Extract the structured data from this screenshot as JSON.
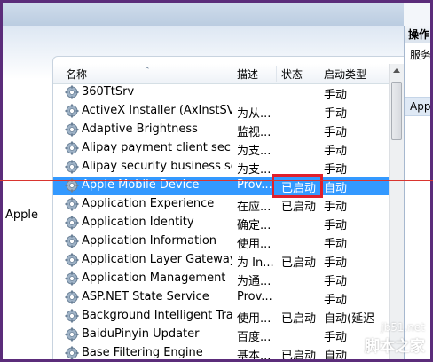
{
  "left_label": "Apple",
  "right_panel": {
    "header": "操作",
    "item1": "服务",
    "item2": "App"
  },
  "columns": {
    "name": "名称",
    "desc": "描述",
    "status": "状态",
    "start_type": "启动类型"
  },
  "rows": [
    {
      "name": "360TtSrv",
      "desc": "",
      "status": "",
      "start": "手动"
    },
    {
      "name": "ActiveX Installer (AxInstSV)",
      "desc": "为从...",
      "status": "",
      "start": "手动"
    },
    {
      "name": "Adaptive Brightness",
      "desc": "监视...",
      "status": "",
      "start": "手动"
    },
    {
      "name": "Alipay payment client secur...",
      "desc": "为支...",
      "status": "",
      "start": "手动"
    },
    {
      "name": "Alipay security business ser...",
      "desc": "为支...",
      "status": "",
      "start": "手动"
    },
    {
      "name": "Apple Mobile Device",
      "desc": "Prov...",
      "status": "已启动",
      "start": "自动",
      "selected": true
    },
    {
      "name": "Application Experience",
      "desc": "在应...",
      "status": "已启动",
      "start": "手动"
    },
    {
      "name": "Application Identity",
      "desc": "确定...",
      "status": "",
      "start": "手动"
    },
    {
      "name": "Application Information",
      "desc": "使用...",
      "status": "",
      "start": "手动"
    },
    {
      "name": "Application Layer Gateway ...",
      "desc": "为 In...",
      "status": "已启动",
      "start": "手动"
    },
    {
      "name": "Application Management",
      "desc": "为通...",
      "status": "",
      "start": "手动"
    },
    {
      "name": "ASP.NET State Service",
      "desc": "Prov...",
      "status": "",
      "start": "手动"
    },
    {
      "name": "Background Intelligent Tra...",
      "desc": "使用...",
      "status": "已启动",
      "start": "自动(延迟"
    },
    {
      "name": "BaiduPinyin Updater",
      "desc": "百度...",
      "status": "",
      "start": "手动"
    },
    {
      "name": "Base Filtering Engine",
      "desc": "基本...",
      "status": "已启动",
      "start": "自动"
    }
  ],
  "watermark": {
    "url": "jb51.net",
    "name": "脚本之家"
  },
  "colors": {
    "selection": "#3399ff",
    "highlight_border": "#e0202b",
    "frame": "#5b2c7a"
  },
  "icon": "gear-icon"
}
